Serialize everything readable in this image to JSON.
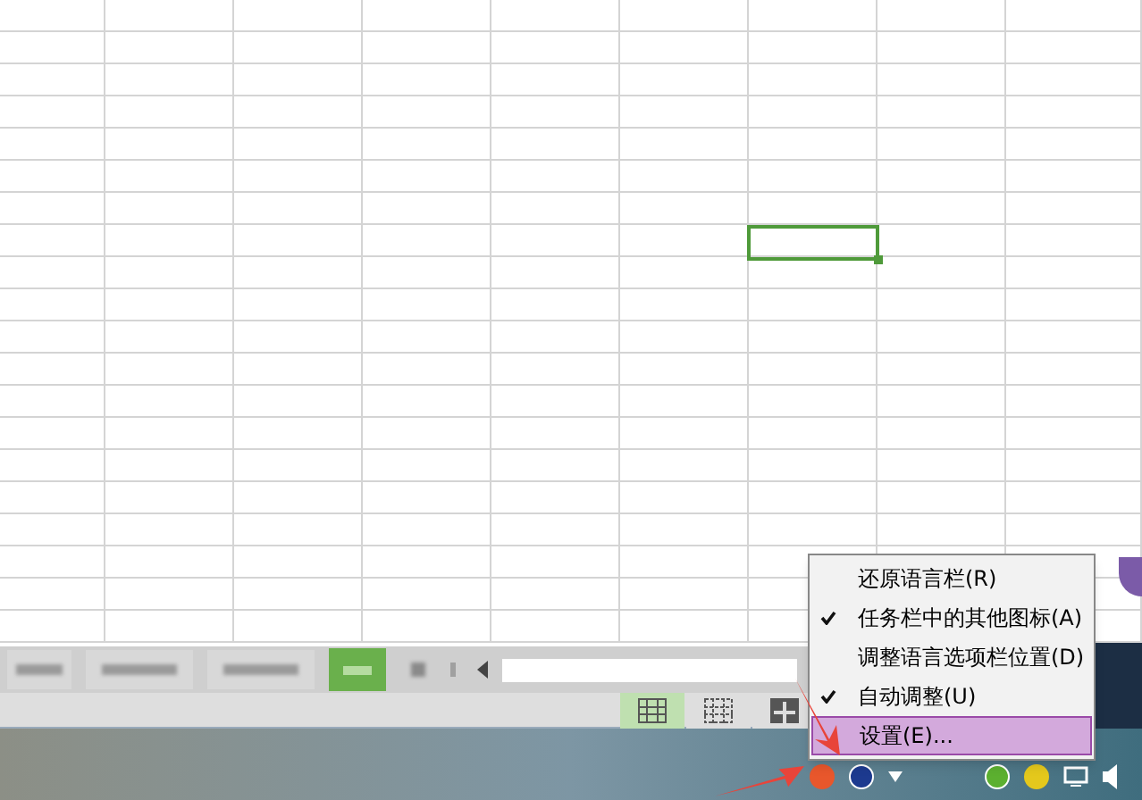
{
  "sheet_tabs": [
    {
      "selected": false
    },
    {
      "selected": false
    },
    {
      "selected": false
    },
    {
      "selected": true
    }
  ],
  "view_buttons": [
    {
      "selected": true
    },
    {
      "selected": false
    },
    {
      "selected": false
    }
  ],
  "context_menu": {
    "items": [
      {
        "label": "还原语言栏(R)",
        "checked": false,
        "selected": false
      },
      {
        "label": "任务栏中的其他图标(A)",
        "checked": true,
        "selected": false
      },
      {
        "label": "调整语言选项栏位置(D)",
        "checked": false,
        "selected": false
      },
      {
        "label": "自动调整(U)",
        "checked": true,
        "selected": false
      },
      {
        "label": "设置(E)...",
        "checked": false,
        "selected": true
      }
    ]
  }
}
